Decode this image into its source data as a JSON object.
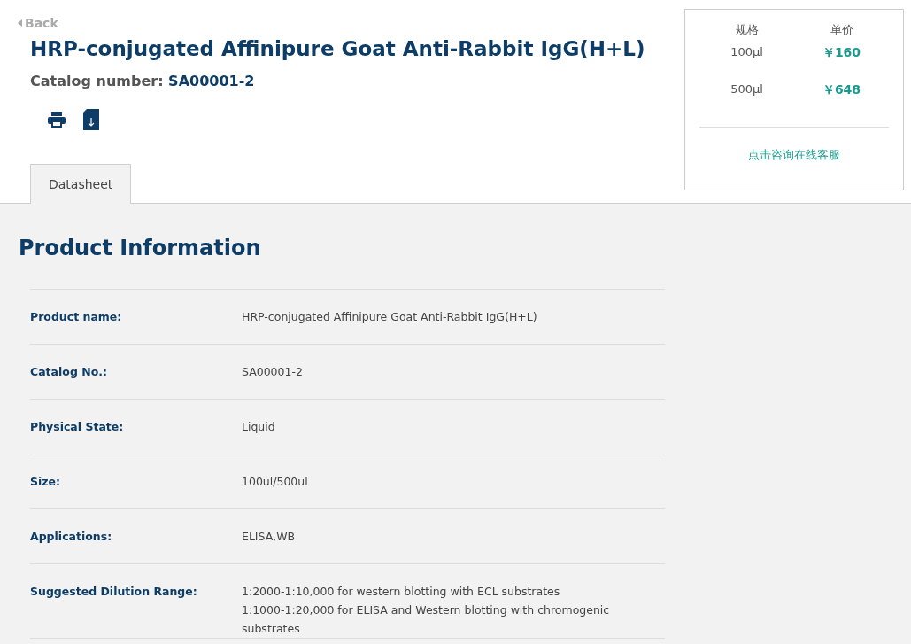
{
  "back_link": "Back",
  "title": "HRP-conjugated Affinipure Goat Anti-Rabbit IgG(H+L)",
  "catalog": {
    "label": "Catalog number:",
    "value": "SA00001-2"
  },
  "tabs": [
    {
      "label": "Datasheet",
      "selected": true
    }
  ],
  "price_panel": {
    "columns": [
      "规格",
      "单价"
    ],
    "rows": [
      {
        "size": "100μl",
        "price": "￥160"
      },
      {
        "size": "500μl",
        "price": "￥648"
      }
    ],
    "contact_link": "点击咨询在线客服"
  },
  "section_title": "Product Information",
  "info_rows": [
    {
      "label": "Product name:",
      "lines": [
        "HRP-conjugated Affinipure Goat Anti-Rabbit IgG(H+L)"
      ]
    },
    {
      "label": "Catalog No.:",
      "lines": [
        "SA00001-2"
      ]
    },
    {
      "label": "Physical State:",
      "lines": [
        "Liquid"
      ]
    },
    {
      "label": "Size:",
      "lines": [
        "100ul/500ul"
      ]
    },
    {
      "label": "Applications:",
      "lines": [
        "ELISA,WB"
      ]
    },
    {
      "label": "Suggested Dilution Range:",
      "lines": [
        "1:2000-1:10,000 for western blotting with ECL substrates",
        "1:1000-1:20,000 for ELISA and Western blotting with chromogenic substrates"
      ]
    }
  ]
}
